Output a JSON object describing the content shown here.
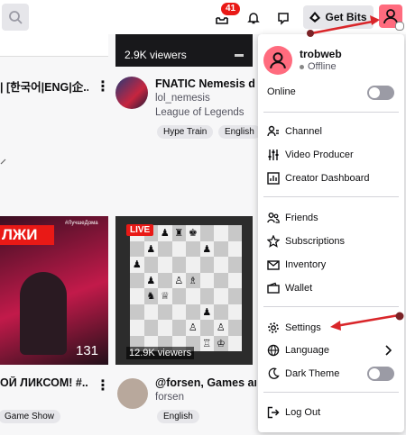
{
  "topbar": {
    "notification_count": "41",
    "get_bits_label": "Get Bits"
  },
  "cards": [
    {
      "title": "| [한국어|ENG|企...",
      "thumb_viewers": ""
    },
    {
      "title": "FNATIC Nemesis du",
      "channel": "lol_nemesis",
      "category": "League of Legends",
      "tags": [
        "Hype Train",
        "English"
      ],
      "thumb_viewers": "2.9K viewers"
    },
    {
      "title": "ОЙ ЛИКСОМ! #...",
      "tags": [
        "Game Show"
      ],
      "thumb_overlay": "ЛЖИ",
      "thumb_number": "131",
      "thumb_hashtag": "#ЛучшеДома"
    },
    {
      "title": "@forsen, Games and",
      "channel": "forsen",
      "tags": [
        "English"
      ],
      "thumb_viewers": "12.9K viewers",
      "live_label": "LIVE"
    }
  ],
  "menu": {
    "username": "trobweb",
    "status": "Offline",
    "online_label": "Online",
    "items_creator": [
      "Channel",
      "Video Producer",
      "Creator Dashboard"
    ],
    "items_account": [
      "Friends",
      "Subscriptions",
      "Inventory",
      "Wallet"
    ],
    "items_prefs": [
      "Settings",
      "Language",
      "Dark Theme"
    ],
    "logout": "Log Out"
  },
  "colors": {
    "accent": "#e91916",
    "avatar": "#ff6b7e",
    "annotation_arrow": "#d9262a"
  }
}
